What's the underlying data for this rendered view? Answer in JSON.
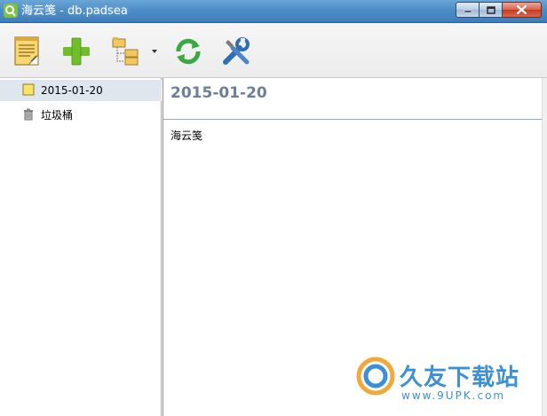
{
  "window": {
    "title": "海云笺 - db.padsea",
    "controls": {
      "minimize": "minimize",
      "maximize": "maximize",
      "close": "close"
    }
  },
  "toolbar": {
    "buttons": [
      {
        "name": "new-note",
        "icon": "note-pad-icon"
      },
      {
        "name": "add",
        "icon": "plus-icon"
      },
      {
        "name": "folders",
        "icon": "folder-tree-icon"
      },
      {
        "name": "refresh",
        "icon": "refresh-icon"
      },
      {
        "name": "settings",
        "icon": "tools-icon"
      }
    ]
  },
  "tree": {
    "items": [
      {
        "label": "2015-01-20",
        "icon": "yellow-note-icon",
        "selected": true
      },
      {
        "label": "垃圾桶",
        "icon": "trash-icon",
        "selected": false
      }
    ]
  },
  "note": {
    "title": "2015-01-20",
    "body": "海云笺"
  },
  "watermark": {
    "text": "久友下载站",
    "sub": "www.9UPK.com"
  },
  "colors": {
    "title_bar": "#4f8fc9",
    "note_title": "#6b7f99",
    "selected_row": "#dfe6ee",
    "plus_green": "#6fbf2a",
    "watermark": "#3d8fd6"
  }
}
